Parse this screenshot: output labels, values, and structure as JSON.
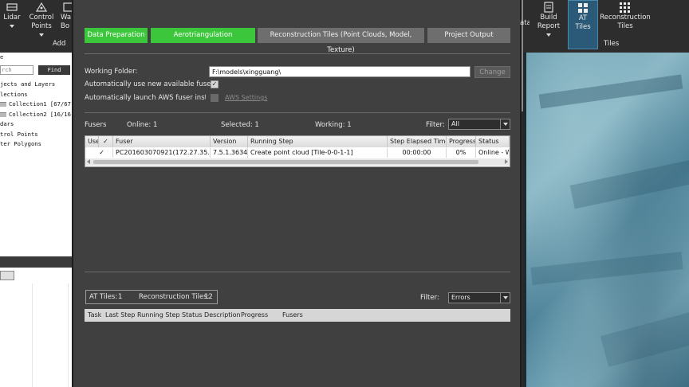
{
  "ribbon": {
    "lidar": "Lidar",
    "control_points": [
      "Control",
      "Points"
    ],
    "wa_cut": [
      "Wa",
      "Bo"
    ],
    "group_add": "Add",
    "ata_cut": "ata",
    "build_report": [
      "Build",
      "Report"
    ],
    "at_tiles": [
      "AT",
      "Tiles"
    ],
    "reconstruction_tiles": [
      "Reconstruction",
      "Tiles"
    ],
    "group_tiles": "Tiles"
  },
  "left_panel": {
    "header": "e",
    "search_text": "rch",
    "find_label": "Find",
    "tree": [
      "jects and Layers",
      "lections",
      "Collection1 [67/67]",
      "Collection2 [16/16]",
      "dars",
      "trol Points",
      "ter Polygons"
    ]
  },
  "tabs": {
    "data_preparation": "Data Preparation",
    "aerotriangulation": "Aerotriangulation",
    "reconstruction_tiles": "Reconstruction Tiles (Point Clouds, Model, Texture)",
    "project_output": "Project Output"
  },
  "settings": {
    "working_folder_label": "Working Folder:",
    "working_folder_value": "F:\\models\\xingguang\\",
    "change_button": "Change",
    "auto_use_label": "Automatically use new available fusers:",
    "auto_use_check": "✓",
    "auto_launch_label": "Automatically launch AWS fuser instanc",
    "aws_settings": "AWS Settings"
  },
  "fusers": {
    "label": "Fusers",
    "online": "Online: 1",
    "selected": "Selected: 1",
    "working": "Working: 1",
    "filter_label": "Filter:",
    "filter_value": "All",
    "columns": [
      "Use",
      "Fuser",
      "Version",
      "Running Step",
      "Step Elapsed Time",
      "Progress",
      "Status"
    ],
    "use_header_check": "✓",
    "rows": [
      {
        "use": "✓",
        "fuser": "PC201603070921(172.27.35.1)",
        "version": "7.5.1.3634",
        "running_step": "Create point cloud [Tile-0-0-1-1]",
        "elapsed": "00:00:00",
        "progress": "0%",
        "status": "Online - W"
      }
    ]
  },
  "tiles": {
    "at_label": "AT Tiles:",
    "at_count": "1",
    "rec_label": "Reconstruction Tiles:",
    "rec_count": "12",
    "filter_label": "Filter:",
    "filter_value": "Errors",
    "columns": [
      "Task",
      "Last Step",
      "Running Step",
      "Status Description",
      "Progress",
      "Fusers"
    ]
  },
  "colors": {
    "tab_active": "#3cc63c",
    "tab_inactive": "#6e6e6e",
    "dialog_bg": "#404040",
    "selected_ribbon": "#2a5a78"
  }
}
